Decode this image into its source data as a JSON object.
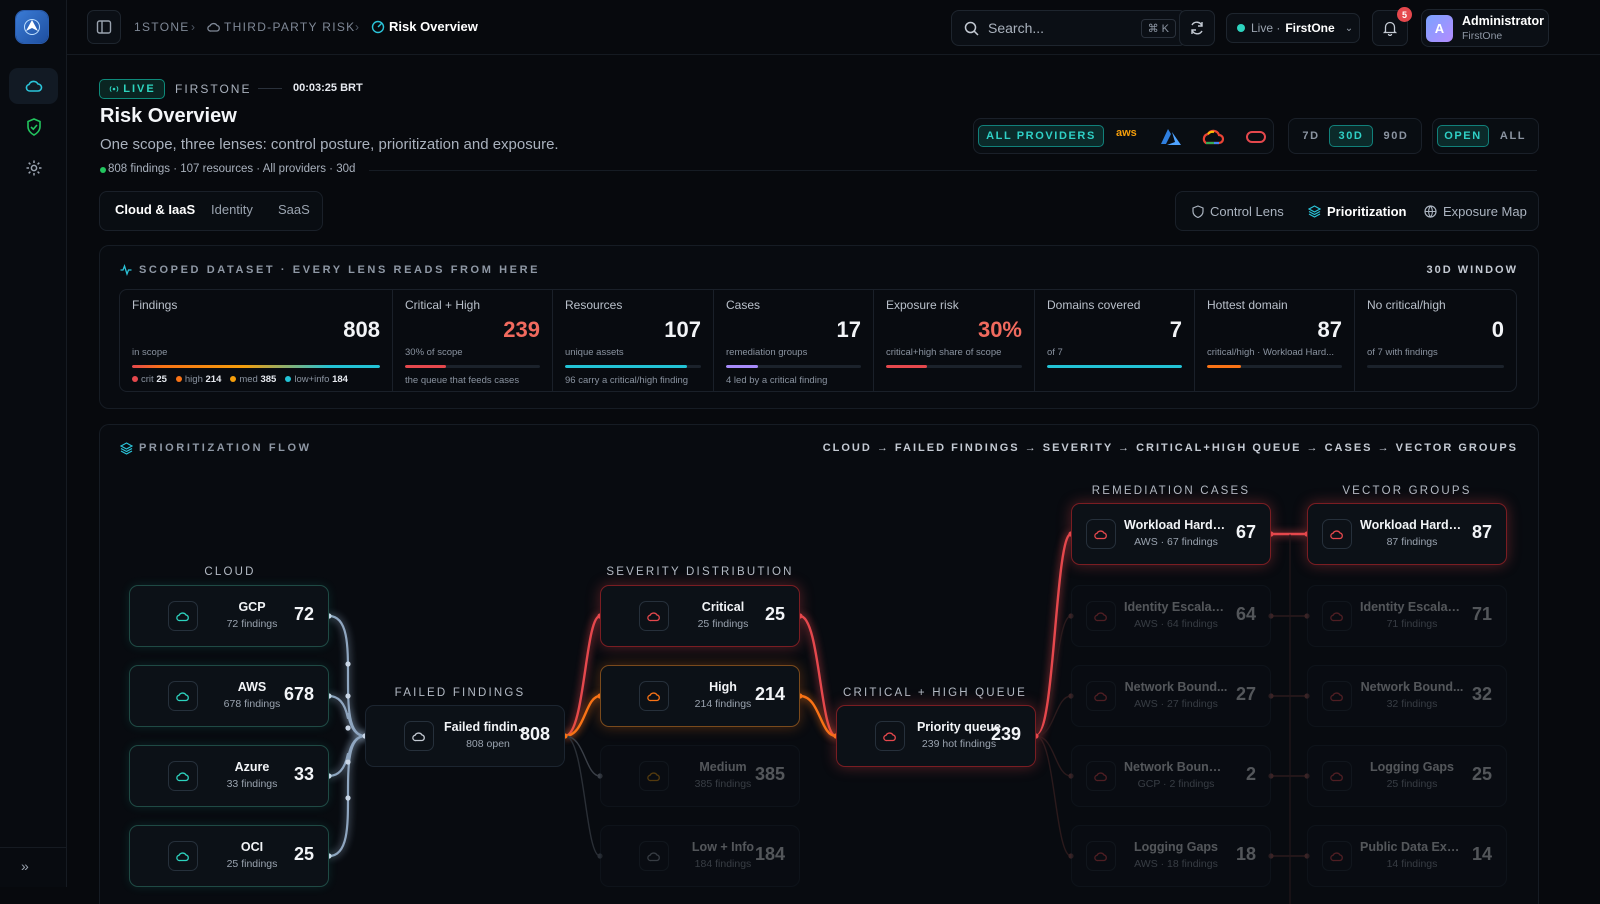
{
  "nav": {
    "breadcrumb": [
      "1STONE",
      "THIRD-PARTY RISK",
      "Risk Overview"
    ],
    "search_placeholder": "Search...",
    "search_shortcut": "⌘ K",
    "env_status": "Live ·",
    "env_name": "FirstOne",
    "notifications": "5",
    "user": {
      "initial": "A",
      "name": "Administrator",
      "org": "FirstOne"
    }
  },
  "header": {
    "live": "LIVE",
    "tenant": "FIRSTONE",
    "clock": "00:03:25 BRT",
    "title": "Risk Overview",
    "subtitle": "One scope, three lenses: control posture, prioritization and exposure.",
    "meta": "808 findings · 107 resources · All providers · 30d"
  },
  "filters": {
    "providers_all": "ALL PROVIDERS",
    "provider_aws": "aws",
    "windows": [
      "7D",
      "30D",
      "90D"
    ],
    "window_selected": "30D",
    "status": [
      "OPEN",
      "ALL"
    ],
    "status_selected": "OPEN"
  },
  "scope_tabs": [
    "Cloud & IaaS",
    "Identity",
    "SaaS"
  ],
  "lenses": [
    "Control Lens",
    "Prioritization",
    "Exposure Map"
  ],
  "dataset": {
    "heading": "SCOPED DATASET · EVERY LENS READS FROM HERE",
    "window": "30D WINDOW",
    "kpis": [
      {
        "label": "Findings",
        "value": "808",
        "sub": "in scope",
        "fill": 1.0,
        "color": "#f59e0b"
      },
      {
        "label": "Critical + High",
        "value": "239",
        "sub": "30% of scope",
        "note": "the queue that feeds cases",
        "fill": 0.3,
        "color": "#e5484d"
      },
      {
        "label": "Resources",
        "value": "107",
        "sub": "unique assets",
        "note": "96 carry a critical/high finding",
        "fill": 0.9,
        "color": "#22c3d6"
      },
      {
        "label": "Cases",
        "value": "17",
        "sub": "remediation groups",
        "note": "4 led by a critical finding",
        "fill": 0.24,
        "color": "#a78bfa"
      },
      {
        "label": "Exposure risk",
        "value": "30%",
        "sub": "critical+high share of scope",
        "fill": 0.3,
        "color": "#e5484d"
      },
      {
        "label": "Domains covered",
        "value": "7",
        "sub": "of 7",
        "fill": 1.0,
        "color": "#22c3d6"
      },
      {
        "label": "Hottest domain",
        "value": "87",
        "sub": "critical/high · Workload Hard...",
        "fill": 0.25,
        "color": "#f97316"
      },
      {
        "label": "No critical/high",
        "value": "0",
        "sub": "of 7 with findings",
        "fill": 0,
        "color": "#22c3d6"
      }
    ],
    "severity_legend": [
      {
        "label": "crit",
        "value": "25",
        "color": "#e5484d"
      },
      {
        "label": "high",
        "value": "214",
        "color": "#f97316"
      },
      {
        "label": "med",
        "value": "385",
        "color": "#f59e0b"
      },
      {
        "label": "low+info",
        "value": "184",
        "color": "#22c3d6"
      }
    ]
  },
  "flow": {
    "heading": "PRIORITIZATION FLOW",
    "path": "CLOUD → FAILED FINDINGS → SEVERITY → CRITICAL+HIGH QUEUE → CASES → VECTOR GROUPS",
    "columns": [
      "CLOUD",
      "FAILED FINDINGS",
      "SEVERITY DISTRIBUTION",
      "CRITICAL + HIGH QUEUE",
      "REMEDIATION CASES",
      "VECTOR GROUPS"
    ],
    "cloud": [
      {
        "name": "GCP",
        "sub": "72 findings",
        "value": "72"
      },
      {
        "name": "AWS",
        "sub": "678 findings",
        "value": "678"
      },
      {
        "name": "Azure",
        "sub": "33 findings",
        "value": "33"
      },
      {
        "name": "OCI",
        "sub": "25 findings",
        "value": "25"
      }
    ],
    "failed": {
      "name": "Failed findings",
      "sub": "808 open",
      "value": "808"
    },
    "severity": [
      {
        "name": "Critical",
        "sub": "25 findings",
        "value": "25"
      },
      {
        "name": "High",
        "sub": "214 findings",
        "value": "214"
      },
      {
        "name": "Medium",
        "sub": "385 findings",
        "value": "385"
      },
      {
        "name": "Low + Info",
        "sub": "184 findings",
        "value": "184"
      }
    ],
    "queue": {
      "name": "Priority queue",
      "sub": "239 hot findings",
      "value": "239"
    },
    "cases": [
      {
        "name": "Workload Harde...",
        "sub": "AWS · 67 findings",
        "value": "67"
      },
      {
        "name": "Identity Escalati...",
        "sub": "AWS · 64 findings",
        "value": "64"
      },
      {
        "name": "Network Bound...",
        "sub": "AWS · 27 findings",
        "value": "27"
      },
      {
        "name": "Network Boundary",
        "sub": "GCP · 2 findings",
        "value": "2"
      },
      {
        "name": "Logging Gaps",
        "sub": "AWS · 18 findings",
        "value": "18"
      }
    ],
    "vectors": [
      {
        "name": "Workload Harde...",
        "sub": "87 findings",
        "value": "87"
      },
      {
        "name": "Identity Escalati...",
        "sub": "71 findings",
        "value": "71"
      },
      {
        "name": "Network Bound...",
        "sub": "32 findings",
        "value": "32"
      },
      {
        "name": "Logging Gaps",
        "sub": "25 findings",
        "value": "25"
      },
      {
        "name": "Public Data Exp...",
        "sub": "14 findings",
        "value": "14"
      }
    ]
  }
}
